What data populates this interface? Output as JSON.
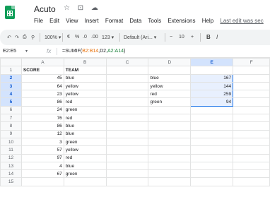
{
  "doc": {
    "title": "Acuto",
    "title_icons": "☆ ⊡ ☁"
  },
  "menu": [
    "File",
    "Edit",
    "View",
    "Insert",
    "Format",
    "Data",
    "Tools",
    "Extensions",
    "Help"
  ],
  "last_edit": "Last edit was sec",
  "toolbar": {
    "undo": "↶",
    "redo": "↷",
    "print": "⎙",
    "paint": "⚲",
    "zoom": "100% ▾",
    "currency": "€",
    "percent": "%",
    "dec_less": ".0",
    "dec_more": ".00",
    "format_123": "123 ▾",
    "font": "Default (Ari... ▾",
    "size_minus": "−",
    "font_size": "10",
    "size_plus": "+",
    "bold": "B",
    "italic": "I"
  },
  "formula_bar": {
    "name_box": "E2:E5",
    "name_arrow": "▾",
    "fx": "fx",
    "formula_prefix": "=SUMIF(",
    "formula_range1": "B2:B14",
    "formula_mid": ",D2,",
    "formula_range2": "A2:A14",
    "formula_suffix": ")"
  },
  "sheet": {
    "columns": [
      "A",
      "B",
      "C",
      "D",
      "E",
      "F"
    ],
    "rows": [
      {
        "n": "1",
        "a": "SCORE",
        "b": "TEAM",
        "c": "",
        "d": "",
        "e": "",
        "f": ""
      },
      {
        "n": "2",
        "a": "45",
        "b": "blue",
        "c": "",
        "d": "blue",
        "e": "167",
        "f": ""
      },
      {
        "n": "3",
        "a": "64",
        "b": "yellow",
        "c": "",
        "d": "yellow",
        "e": "144",
        "f": ""
      },
      {
        "n": "4",
        "a": "23",
        "b": "yellow",
        "c": "",
        "d": "red",
        "e": "259",
        "f": ""
      },
      {
        "n": "5",
        "a": "86",
        "b": "red",
        "c": "",
        "d": "green",
        "e": "94",
        "f": ""
      },
      {
        "n": "6",
        "a": "24",
        "b": "green",
        "c": "",
        "d": "",
        "e": "",
        "f": ""
      },
      {
        "n": "7",
        "a": "76",
        "b": "red",
        "c": "",
        "d": "",
        "e": "",
        "f": ""
      },
      {
        "n": "8",
        "a": "86",
        "b": "blue",
        "c": "",
        "d": "",
        "e": "",
        "f": ""
      },
      {
        "n": "9",
        "a": "12",
        "b": "blue",
        "c": "",
        "d": "",
        "e": "",
        "f": ""
      },
      {
        "n": "10",
        "a": "3",
        "b": "green",
        "c": "",
        "d": "",
        "e": "",
        "f": ""
      },
      {
        "n": "11",
        "a": "57",
        "b": "yellow",
        "c": "",
        "d": "",
        "e": "",
        "f": ""
      },
      {
        "n": "12",
        "a": "97",
        "b": "red",
        "c": "",
        "d": "",
        "e": "",
        "f": ""
      },
      {
        "n": "13",
        "a": "4",
        "b": "blue",
        "c": "",
        "d": "",
        "e": "",
        "f": ""
      },
      {
        "n": "14",
        "a": "67",
        "b": "green",
        "c": "",
        "d": "",
        "e": "",
        "f": ""
      },
      {
        "n": "15",
        "a": "",
        "b": "",
        "c": "",
        "d": "",
        "e": "",
        "f": ""
      }
    ]
  },
  "colors": {
    "brand": "#0f9d58",
    "selection_border": "#1a73e8",
    "selection_fill": "#e8f0fe"
  }
}
